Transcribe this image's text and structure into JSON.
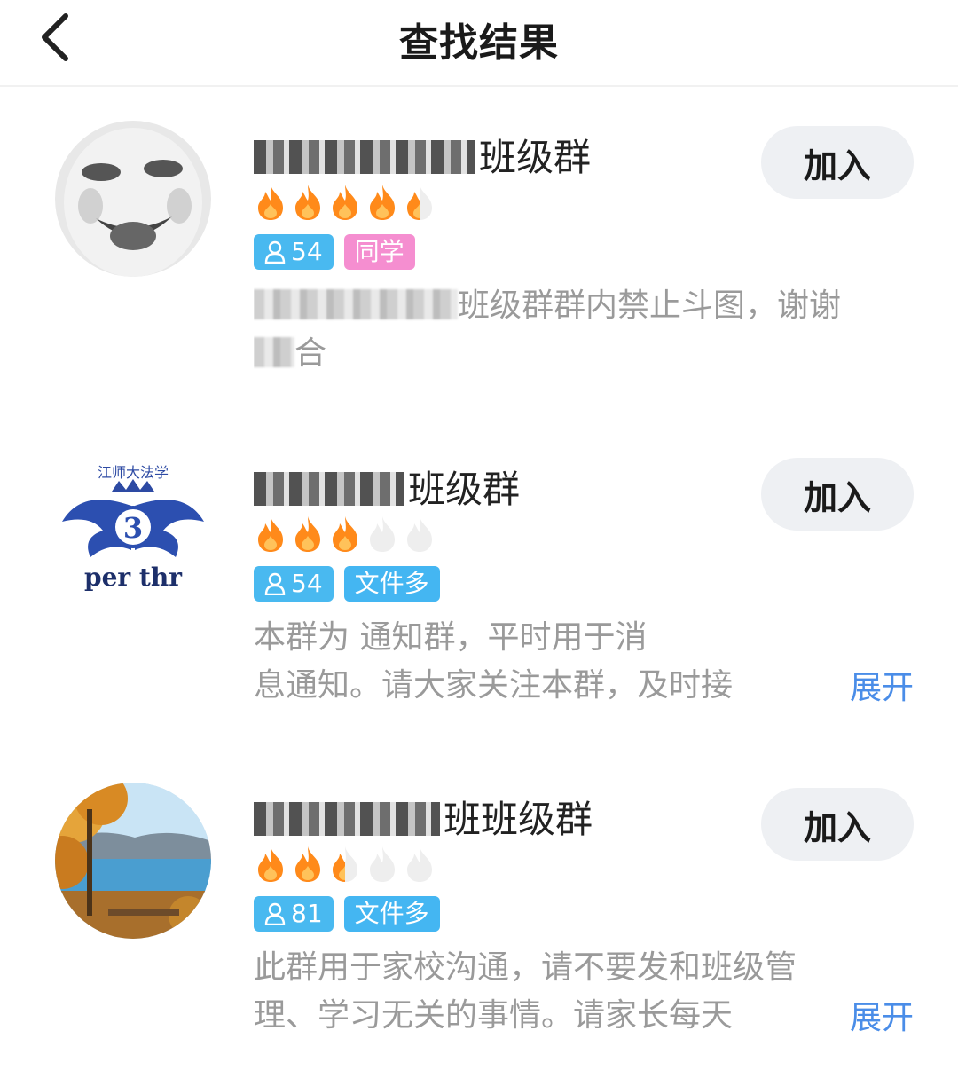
{
  "header": {
    "title": "查找结果"
  },
  "groups": [
    {
      "name": "班级群",
      "tags": {
        "members": "54",
        "type": "同学"
      },
      "description": [
        "班级群群内禁止斗图，谢谢",
        "合"
      ],
      "join_label": "加入",
      "flames_lit": 4.5,
      "flames_total": 5
    },
    {
      "name": "班级群",
      "tags": {
        "members": "54",
        "type": "文件多"
      },
      "description": [
        "本群为 通知群，平时用于消",
        "息通知。请大家关注本群，及时接"
      ],
      "expand_label": "展开",
      "join_label": "加入",
      "flames_lit": 3,
      "flames_total": 5
    },
    {
      "name": "班班级群",
      "tags": {
        "members": "81",
        "type": "文件多"
      },
      "description": [
        "此群用于家校沟通，请不要发和班级管",
        "理、学习无关的事情。请家长每天"
      ],
      "expand_label": "展开",
      "join_label": "加入",
      "flames_lit": 2.5,
      "flames_total": 5
    }
  ],
  "avatars": {
    "g2_caption": "per thr",
    "g2_top_text": "江师大法学"
  },
  "colors": {
    "accent_blue": "#4a8de8",
    "tag_blue": "#49b9f0",
    "tag_pink": "#f58ed0",
    "flame_lit": "#ff8a1a",
    "flame_unlit": "#eeeeee"
  }
}
